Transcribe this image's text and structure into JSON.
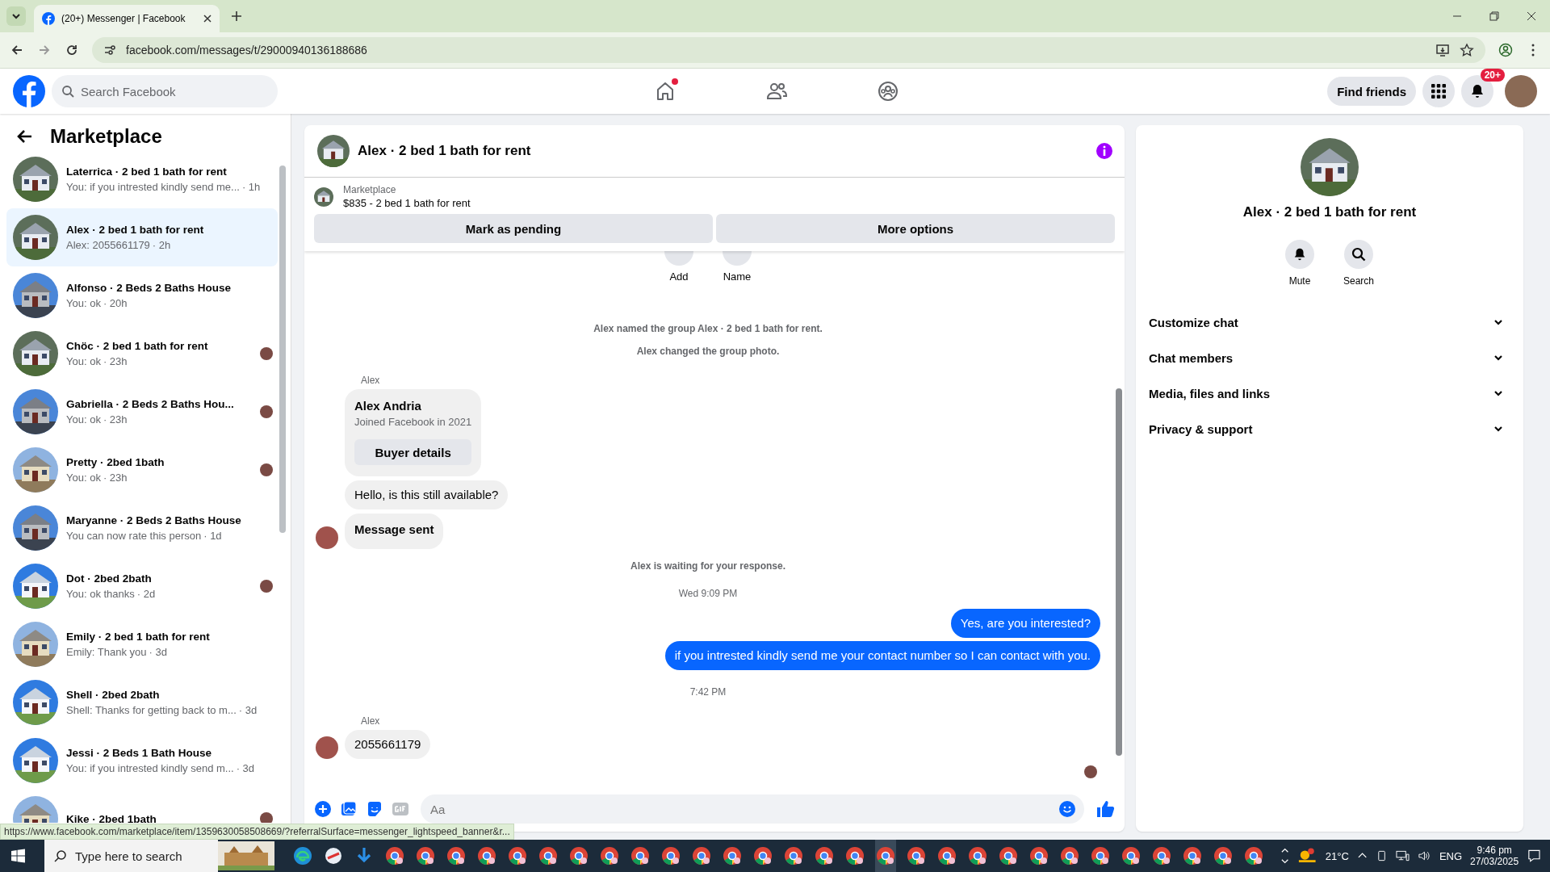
{
  "browser": {
    "tab_title": "(20+) Messenger | Facebook",
    "url": "facebook.com/messages/t/29000940136188686"
  },
  "header": {
    "search": {
      "placeholder": "Search Facebook"
    },
    "home_alert": true,
    "find_friends": "Find friends",
    "notification_badge": "20+"
  },
  "sidebar": {
    "title": "Marketplace",
    "conversations": [
      {
        "name": "Laterrica · 2 bed 1 bath for rent",
        "preview": "You: if you intrested kindly send me...",
        "time": "· 1h",
        "selected": false,
        "seen": false
      },
      {
        "name": "Alex · 2 bed 1 bath for rent",
        "preview": "Alex: 2055661179",
        "time": "· 2h",
        "selected": true,
        "seen": false
      },
      {
        "name": "Alfonso · 2 Beds 2 Baths House",
        "preview": "You: ok",
        "time": "· 20h",
        "selected": false,
        "seen": false
      },
      {
        "name": "Chöc · 2 bed 1 bath for rent",
        "preview": "You: ok",
        "time": "· 23h",
        "selected": false,
        "seen": true
      },
      {
        "name": "Gabriella · 2 Beds 2 Baths Hou...",
        "preview": "You: ok",
        "time": "· 23h",
        "selected": false,
        "seen": true
      },
      {
        "name": "Pretty · 2bed 1bath",
        "preview": "You: ok",
        "time": "· 23h",
        "selected": false,
        "seen": true
      },
      {
        "name": "Maryanne · 2 Beds 2 Baths House",
        "preview": "You can now rate this person",
        "time": "· 1d",
        "selected": false,
        "seen": false
      },
      {
        "name": "Dot · 2bed 2bath",
        "preview": "You: ok thanks",
        "time": "· 2d",
        "selected": false,
        "seen": true
      },
      {
        "name": "Emily · 2 bed 1 bath for rent",
        "preview": "Emily: Thank you",
        "time": "· 3d",
        "selected": false,
        "seen": false
      },
      {
        "name": "Shell · 2bed 2bath",
        "preview": "Shell: Thanks for getting back to m...",
        "time": "· 3d",
        "selected": false,
        "seen": false
      },
      {
        "name": "Jessi · 2 Beds 1 Bath House",
        "preview": "You: if you intrested kindly send m...",
        "time": "· 3d",
        "selected": false,
        "seen": false
      },
      {
        "name": "Kike · 2bed 1bath",
        "selected": false,
        "seen": true
      }
    ]
  },
  "status_url": "https://www.facebook.com/marketplace/item/1359630058508669/?referralSurface=messenger_lightspeed_banner&r...",
  "chat": {
    "title": "Alex · 2 bed 1 bath for rent",
    "listing": {
      "label": "Marketplace",
      "item": "$835 - 2 bed 1 bath for rent",
      "buttons": [
        "Mark as pending",
        "More options"
      ]
    },
    "top_actions": [
      "Add",
      "Name"
    ],
    "messages": [
      {
        "kind": "event",
        "text": "Alex named the group Alex · 2 bed 1 bath for rent."
      },
      {
        "kind": "event",
        "text": "Alex changed the group photo."
      },
      {
        "kind": "sender",
        "text": "Alex"
      },
      {
        "kind": "profile_card",
        "name": "Alex Andria",
        "subtitle": "Joined Facebook in 2021",
        "button": "Buyer details"
      },
      {
        "kind": "incoming",
        "text": "Hello, is this still available?",
        "bold": false,
        "avatar": false
      },
      {
        "kind": "incoming",
        "text": "Message sent",
        "bold": true,
        "avatar": true
      },
      {
        "kind": "event",
        "text": "Alex is waiting for your response."
      },
      {
        "kind": "time",
        "text": "Wed 9:09 PM"
      },
      {
        "kind": "outgoing",
        "text": "Yes, are you interested?"
      },
      {
        "kind": "outgoing",
        "text": "if you intrested kindly send me your contact number so I can contact with you."
      },
      {
        "kind": "time",
        "text": "7:42 PM"
      },
      {
        "kind": "sender",
        "text": "Alex"
      },
      {
        "kind": "incoming",
        "text": "2055661179",
        "bold": false,
        "avatar": true
      },
      {
        "kind": "seen"
      }
    ],
    "composer": {
      "placeholder": "Aa"
    }
  },
  "details": {
    "title": "Alex · 2 bed 1 bath for rent",
    "actions": [
      "Mute",
      "Search"
    ],
    "sections": [
      {
        "label": "Customize chat",
        "expanded": false
      },
      {
        "label": "Chat members",
        "expanded": false
      },
      {
        "label": "Media, files and links",
        "expanded": false
      },
      {
        "label": "Privacy & support",
        "expanded": false
      }
    ]
  },
  "taskbar": {
    "search": {
      "placeholder": "Type here to search"
    },
    "temperature": "21°C",
    "language": "ENG",
    "time": "9:46 pm",
    "date": "27/03/2025"
  }
}
